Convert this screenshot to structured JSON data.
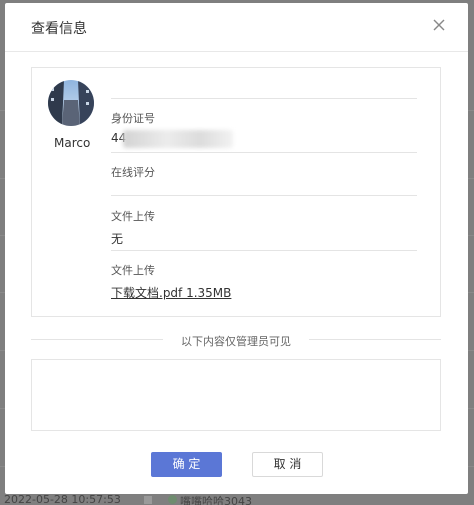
{
  "dialog": {
    "title": "查看信息",
    "close_icon": "close-icon"
  },
  "user": {
    "name": "Marco"
  },
  "fields": {
    "id_card_label": "身份证号",
    "id_card_value": "44",
    "online_rating_label": "在线评分",
    "upload1_label": "文件上传",
    "upload1_value": "无",
    "upload2_label": "文件上传",
    "upload2_file": "下载文档.pdf 1.35MB"
  },
  "admin": {
    "separator_text": "以下内容仅管理员可见"
  },
  "buttons": {
    "ok": "确 定",
    "cancel": "取 消"
  },
  "background": {
    "footer_date": "2022-05-28 10:57:53",
    "footer_name": "嘴嘴哈哈3043"
  },
  "colors": {
    "primary": "#5b77d6",
    "overlay": "#7f7f7f"
  }
}
